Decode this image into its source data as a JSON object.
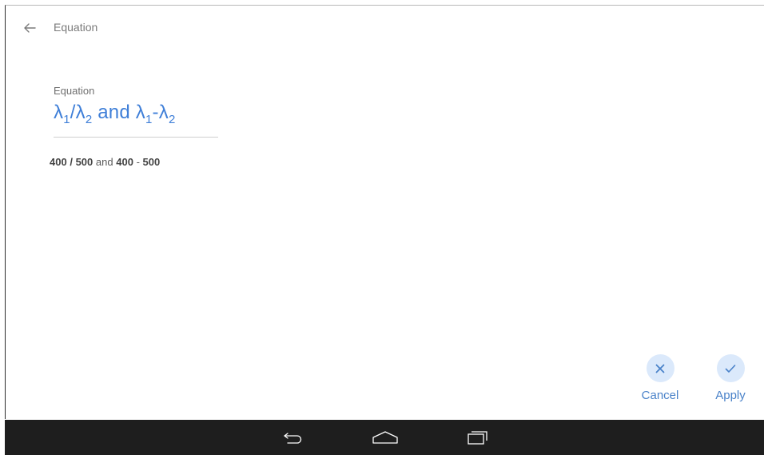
{
  "header": {
    "back_icon": "arrow-left-icon",
    "title": "Equation"
  },
  "equation": {
    "label": "Equation",
    "display": {
      "symbol": "λ",
      "sub1": "1",
      "slash": "/",
      "sub2": "2",
      "conjunction": "and",
      "minus": "-"
    },
    "result": {
      "value_a": "400",
      "divide": "/",
      "value_b": "500",
      "conjunction": "and",
      "value_c": "400",
      "minus": "-",
      "value_d": "500"
    }
  },
  "actions": {
    "cancel": {
      "label": "Cancel",
      "icon": "close-icon"
    },
    "apply": {
      "label": "Apply",
      "icon": "check-icon"
    }
  },
  "navbar": {
    "back_icon": "nav-back-icon",
    "home_icon": "nav-home-icon",
    "recents_icon": "nav-recents-icon"
  },
  "colors": {
    "accent": "#3f7fd8",
    "action_bg": "#dbe9fb",
    "navbar_bg": "#1e1e1e"
  }
}
